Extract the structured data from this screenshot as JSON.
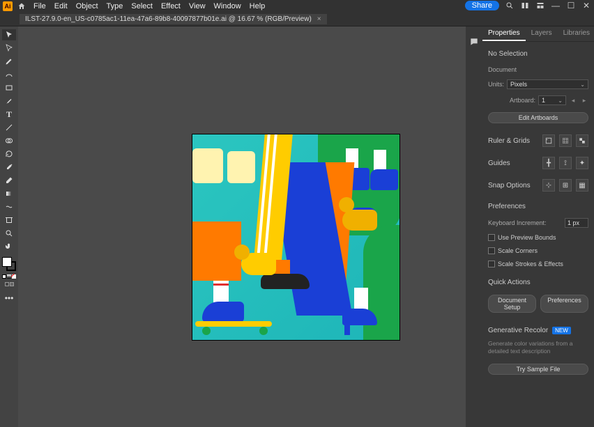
{
  "logo": "Ai",
  "menu": [
    "File",
    "Edit",
    "Object",
    "Type",
    "Select",
    "Effect",
    "View",
    "Window",
    "Help"
  ],
  "share": "Share",
  "tab": {
    "title": "ILST-27.9.0-en_US-c0785ac1-11ea-47a6-89b8-40097877b01e.ai @ 16.67 % (RGB/Preview)",
    "close": "×"
  },
  "panels": {
    "tabs": [
      "Properties",
      "Layers",
      "Libraries"
    ],
    "noSelection": "No Selection",
    "document": "Document",
    "unitsLabel": "Units:",
    "unitsValue": "Pixels",
    "artboardLabel": "Artboard:",
    "artboardValue": "1",
    "editArtboards": "Edit Artboards",
    "rulerGrids": "Ruler & Grids",
    "guides": "Guides",
    "snapOptions": "Snap Options",
    "preferences": "Preferences",
    "keyIncLabel": "Keyboard Increment:",
    "keyIncVal": "1 px",
    "cb1": "Use Preview Bounds",
    "cb2": "Scale Corners",
    "cb3": "Scale Strokes & Effects",
    "quickActions": "Quick Actions",
    "docSetup": "Document Setup",
    "prefsBtn": "Preferences",
    "genRecolor": "Generative Recolor",
    "new": "NEW",
    "genDesc": "Generate color variations from a detailed text description",
    "trySample": "Try Sample File"
  }
}
